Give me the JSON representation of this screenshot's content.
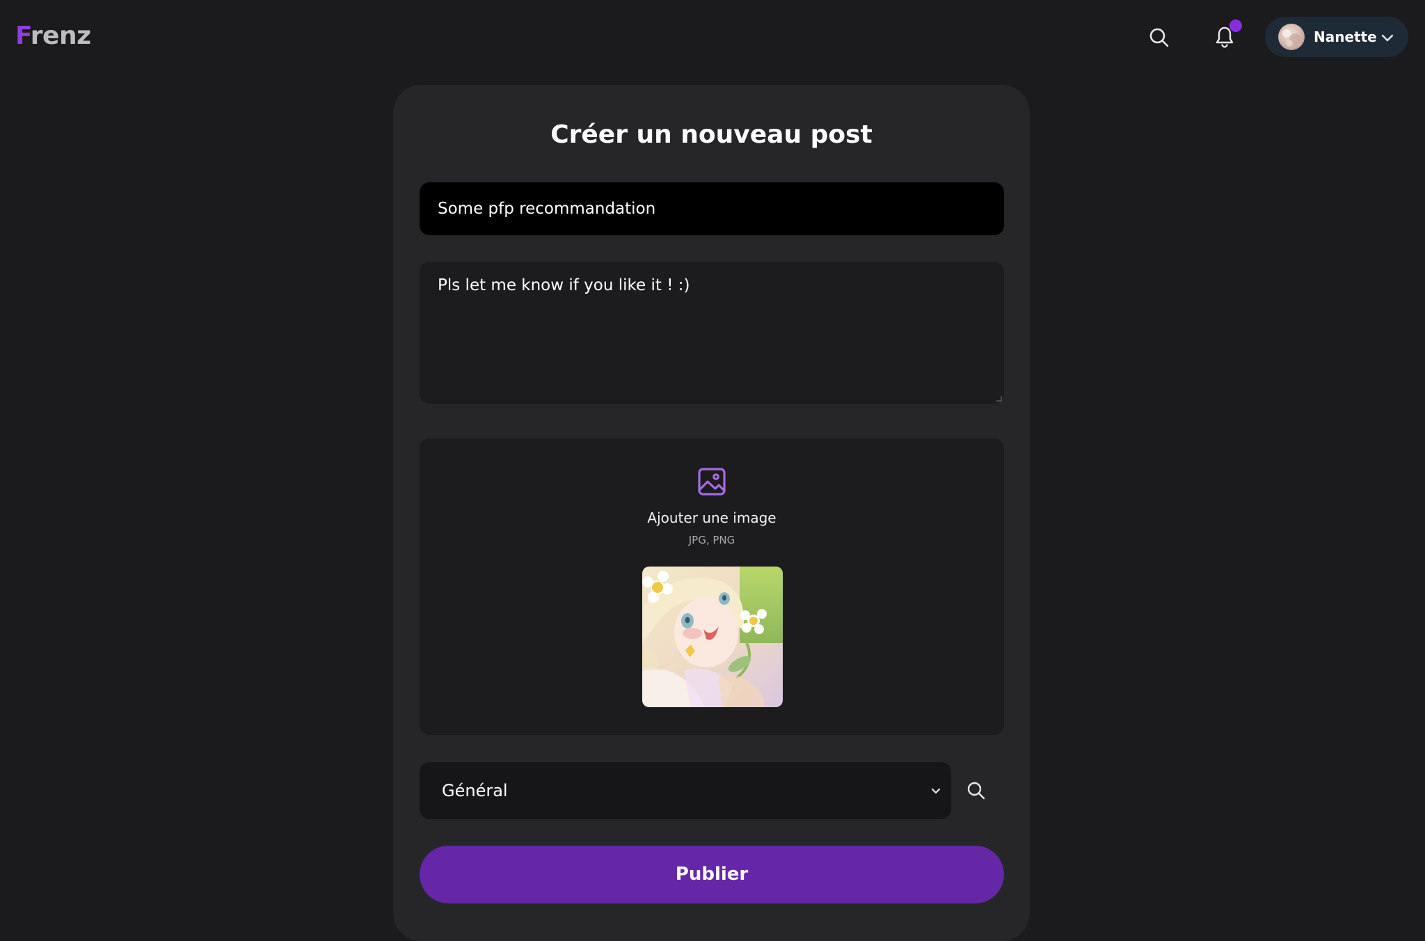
{
  "app": {
    "logo_first": "F",
    "logo_rest": "renz"
  },
  "header": {
    "user_name": "Nanette",
    "notification_dot": true
  },
  "form": {
    "title": "Créer un nouveau post",
    "post_title_value": "Some pfp recommandation",
    "post_body_value": "Pls let me know if you like it ! :)",
    "upload_label": "Ajouter une image",
    "upload_formats": "JPG, PNG",
    "category_selected": "Général",
    "publish_label": "Publier"
  },
  "colors": {
    "accent": "#6526a8",
    "logo_accent": "#8b3fdc",
    "upload_icon": "#a66be0",
    "notification": "#8a2be2"
  },
  "icons": {
    "top_search": "search-icon",
    "bell": "bell-icon",
    "user_dropdown": "chevron-down-icon",
    "upload": "image-icon",
    "category_dropdown": "chevron-down-icon",
    "category_search": "search-icon"
  }
}
